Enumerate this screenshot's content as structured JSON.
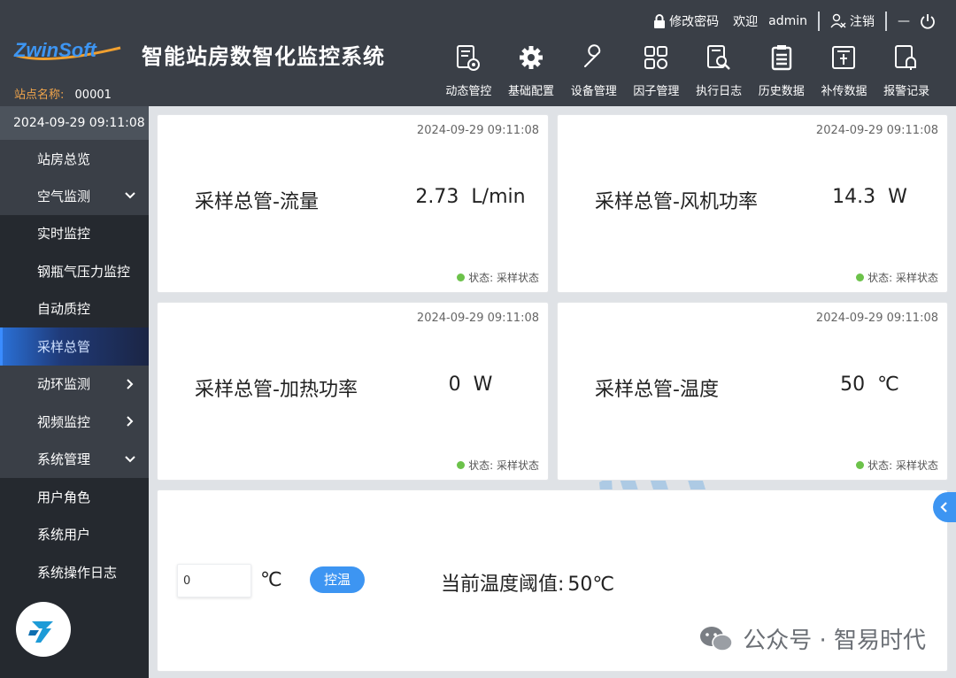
{
  "header": {
    "logo_text": "ZwinSoft",
    "title": "智能站房数智化监控系统",
    "station_label": "站点名称:",
    "station_value": "00001",
    "topbar": {
      "change_password": "修改密码",
      "welcome": "欢迎",
      "username": "admin",
      "logout": "注销",
      "minimize": "—"
    },
    "nav": [
      {
        "label": "动态管控",
        "icon": "dynamic-control-icon"
      },
      {
        "label": "基础配置",
        "icon": "gear-icon"
      },
      {
        "label": "设备管理",
        "icon": "wrench-icon"
      },
      {
        "label": "因子管理",
        "icon": "factor-grid-icon"
      },
      {
        "label": "执行日志",
        "icon": "log-search-icon"
      },
      {
        "label": "历史数据",
        "icon": "clipboard-icon"
      },
      {
        "label": "补传数据",
        "icon": "upload-icon"
      },
      {
        "label": "报警记录",
        "icon": "alarm-bell-icon"
      }
    ]
  },
  "sidebar": {
    "datetime": "2024-09-29 09:11:08",
    "items": [
      {
        "label": "站房总览",
        "type": "top"
      },
      {
        "label": "空气监测",
        "type": "group",
        "expanded": true
      },
      {
        "label": "实时监控",
        "type": "sub"
      },
      {
        "label": "钢瓶气压力监控",
        "type": "sub"
      },
      {
        "label": "自动质控",
        "type": "sub"
      },
      {
        "label": "采样总管",
        "type": "sub",
        "active": true
      },
      {
        "label": "动环监测",
        "type": "group",
        "expanded": false
      },
      {
        "label": "视频监控",
        "type": "group",
        "expanded": false
      },
      {
        "label": "系统管理",
        "type": "group",
        "expanded": true
      },
      {
        "label": "用户角色",
        "type": "sub"
      },
      {
        "label": "系统用户",
        "type": "sub"
      },
      {
        "label": "系统操作日志",
        "type": "sub"
      }
    ]
  },
  "cards": [
    {
      "time": "2024-09-29 09:11:08",
      "name": "采样总管-流量",
      "value": "2.73",
      "unit": "L/min",
      "status": "状态: 采样状态"
    },
    {
      "time": "2024-09-29 09:11:08",
      "name": "采样总管-风机功率",
      "value": "14.3",
      "unit": "W",
      "status": "状态: 采样状态"
    },
    {
      "time": "2024-09-29 09:11:08",
      "name": "采样总管-加热功率",
      "value": "0",
      "unit": "W",
      "status": "状态: 采样状态"
    },
    {
      "time": "2024-09-29 09:11:08",
      "name": "采样总管-温度",
      "value": "50",
      "unit": "℃",
      "status": "状态: 采样状态"
    }
  ],
  "control": {
    "input_value": "0",
    "unit": "℃",
    "button": "控温",
    "threshold_label": "当前温度阈值:",
    "threshold_value": "50℃"
  },
  "wechat": {
    "text": "公众号 · 智易时代"
  },
  "colors": {
    "header_bg": "#3a3f47",
    "sidebar_bg": "#25292f",
    "accent": "#3d95f2",
    "station_label": "#f0a44b",
    "status_dot": "#6cc24a"
  }
}
